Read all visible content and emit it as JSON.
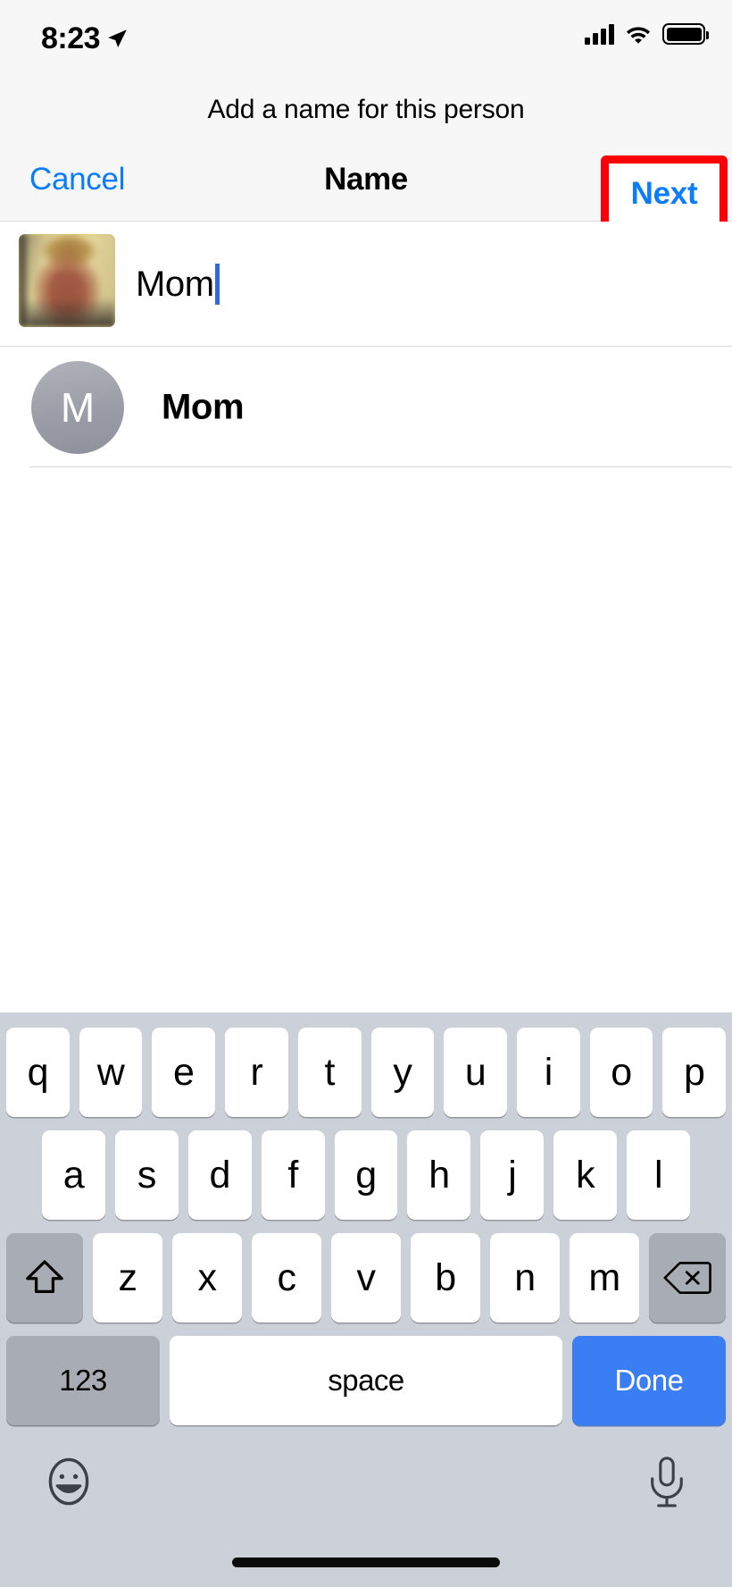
{
  "status_bar": {
    "time": "8:23",
    "location_icon": "location-arrow-icon",
    "signal_icon": "cellular-signal-icon",
    "signal_bars": 4,
    "wifi_icon": "wifi-icon",
    "battery_icon": "battery-full-icon",
    "battery_level": 100
  },
  "prompt": {
    "text": "Add a name for this person"
  },
  "nav_bar": {
    "cancel_label": "Cancel",
    "title": "Name",
    "next_label": "Next",
    "accent_color": "#0a7cff",
    "highlight_color": "#fb0007"
  },
  "photo_row": {
    "thumbnail_name": "person-photo-thumbnail",
    "input_value": "Mom",
    "input_placeholder": "Name",
    "caret_color": "#2f6bd6"
  },
  "suggestion": {
    "avatar_initial": "M",
    "label": "Mom",
    "avatar_color": "#9a9da7"
  },
  "keyboard": {
    "row1": [
      "q",
      "w",
      "e",
      "r",
      "t",
      "y",
      "u",
      "i",
      "o",
      "p"
    ],
    "row2": [
      "a",
      "s",
      "d",
      "f",
      "g",
      "h",
      "j",
      "k",
      "l"
    ],
    "row3": [
      "z",
      "x",
      "c",
      "v",
      "b",
      "n",
      "m"
    ],
    "shift_icon": "shift-arrow-icon",
    "delete_icon": "delete-backspace-icon",
    "numbers_label": "123",
    "space_label": "space",
    "done_label": "Done",
    "done_color": "#3b7df2",
    "emoji_icon": "emoji-smiley-icon",
    "mic_icon": "microphone-icon",
    "background_color": "#ccd0d8"
  }
}
